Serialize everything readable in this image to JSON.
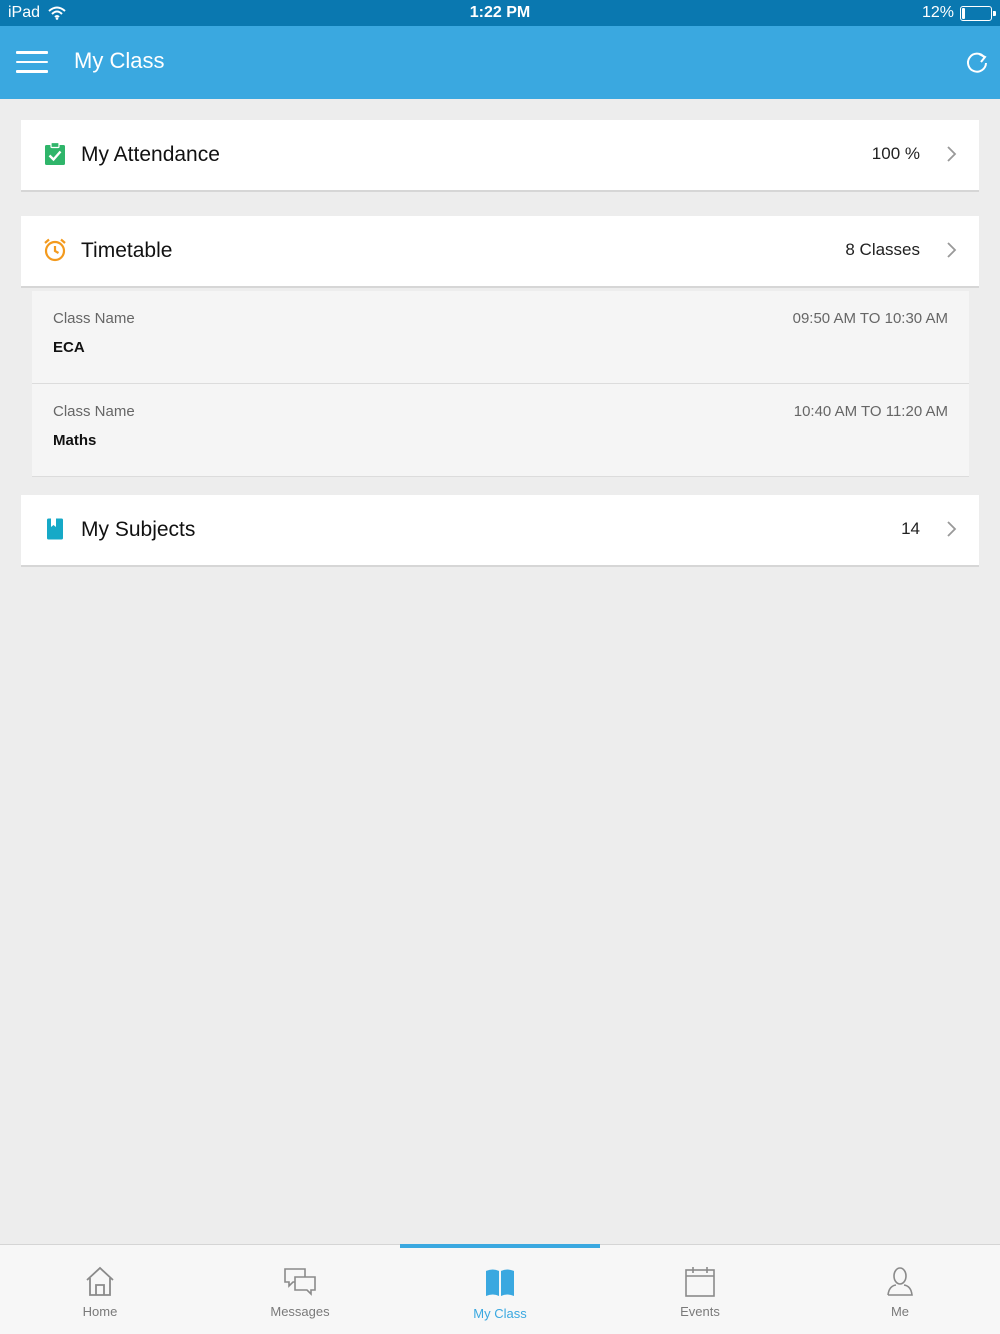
{
  "status_bar": {
    "device": "iPad",
    "time": "1:22 PM",
    "battery_text": "12%",
    "battery_level": 0.12
  },
  "app_bar": {
    "title": "My Class"
  },
  "cards": {
    "attendance": {
      "label": "My Attendance",
      "value": "100 %",
      "icon": "clipboard-check-icon",
      "color": "#2fb56a"
    },
    "timetable": {
      "label": "Timetable",
      "value": "8 Classes",
      "icon": "alarm-clock-icon",
      "color": "#f39a1e"
    },
    "subjects": {
      "label": "My Subjects",
      "value": "14",
      "icon": "book-icon",
      "color": "#16a9c7"
    }
  },
  "timetable_rows": [
    {
      "caption": "Class Name",
      "name": "ECA",
      "time": "09:50 AM TO 10:30 AM"
    },
    {
      "caption": "Class Name",
      "name": "Maths",
      "time": "10:40 AM TO 11:20 AM"
    }
  ],
  "tabs": [
    {
      "label": "Home",
      "icon": "home-icon"
    },
    {
      "label": "Messages",
      "icon": "messages-icon"
    },
    {
      "label": "My Class",
      "icon": "open-book-icon",
      "active": true
    },
    {
      "label": "Events",
      "icon": "calendar-icon"
    },
    {
      "label": "Me",
      "icon": "person-icon"
    }
  ],
  "colors": {
    "status_bar": "#0a78b0",
    "app_bar": "#3aa8e0",
    "accent": "#3aa8e0",
    "background": "#ededed"
  }
}
